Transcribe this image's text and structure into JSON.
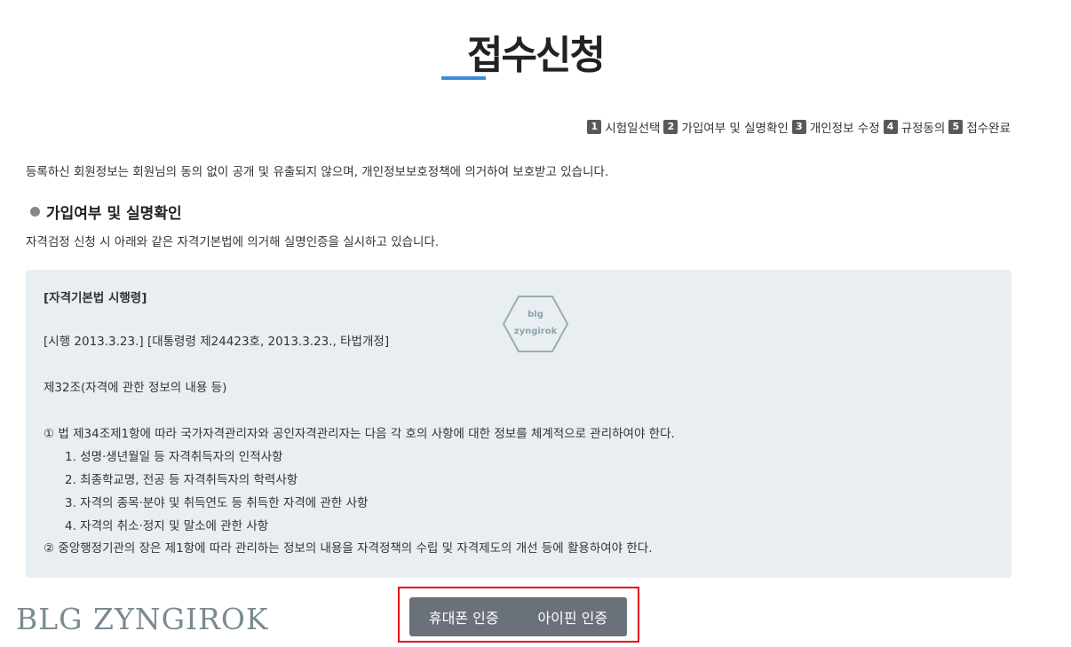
{
  "title": "접수신청",
  "steps": [
    {
      "num": "1",
      "label": "시험일선택"
    },
    {
      "num": "2",
      "label": "가입여부 및 실명확인"
    },
    {
      "num": "3",
      "label": "개인정보 수정"
    },
    {
      "num": "4",
      "label": "규정동의"
    },
    {
      "num": "5",
      "label": "접수완료"
    }
  ],
  "privacy_note": "등록하신 회원정보는 회원님의 동의 없이 공개 및 유출되지 않으며, 개인정보보호정책에 의거하여 보호받고 있습니다.",
  "section": {
    "heading": "가입여부 및 실명확인",
    "description": "자격검정 신청 시 아래와 같은 자격기본법에 의거해 실명인증을 실시하고 있습니다."
  },
  "law": {
    "title": "[자격기본법 시행령]",
    "enforcement": "[시행 2013.3.23.] [대통령령 제24423호, 2013.3.23., 타법개정]",
    "article": "제32조(자격에 관한 정보의 내용 등)",
    "para1": "① 법 제34조제1항에 따라 국가자격관리자와 공인자격관리자는 다음 각 호의 사항에 대한 정보를 체계적으로 관리하여야 한다.",
    "items": [
      "1. 성명·생년월일 등 자격취득자의 인적사항",
      "2. 최종학교명, 전공 등 자격취득자의 학력사항",
      "3. 자격의 종목·분야 및 취득연도 등 취득한 자격에 관한 사항",
      "4. 자격의 취소·정지 및 말소에 관한 사항"
    ],
    "para2": "② 중앙행정기관의 장은 제1항에 따라 관리하는 정보의 내용을 자격정책의 수립 및 자격제도의 개선 등에 활용하여야 한다."
  },
  "watermark": {
    "line1": "blg",
    "line2": "zyngirok"
  },
  "brand": "BLG ZYNGIROK",
  "auth": {
    "phone_label": "휴대폰 인증",
    "ipin_label": "아이핀 인증"
  },
  "colors": {
    "accent": "#3a8fd6",
    "highlight": "#e0141e",
    "button_bg": "#6b7178",
    "box_bg": "#e8eef1"
  }
}
